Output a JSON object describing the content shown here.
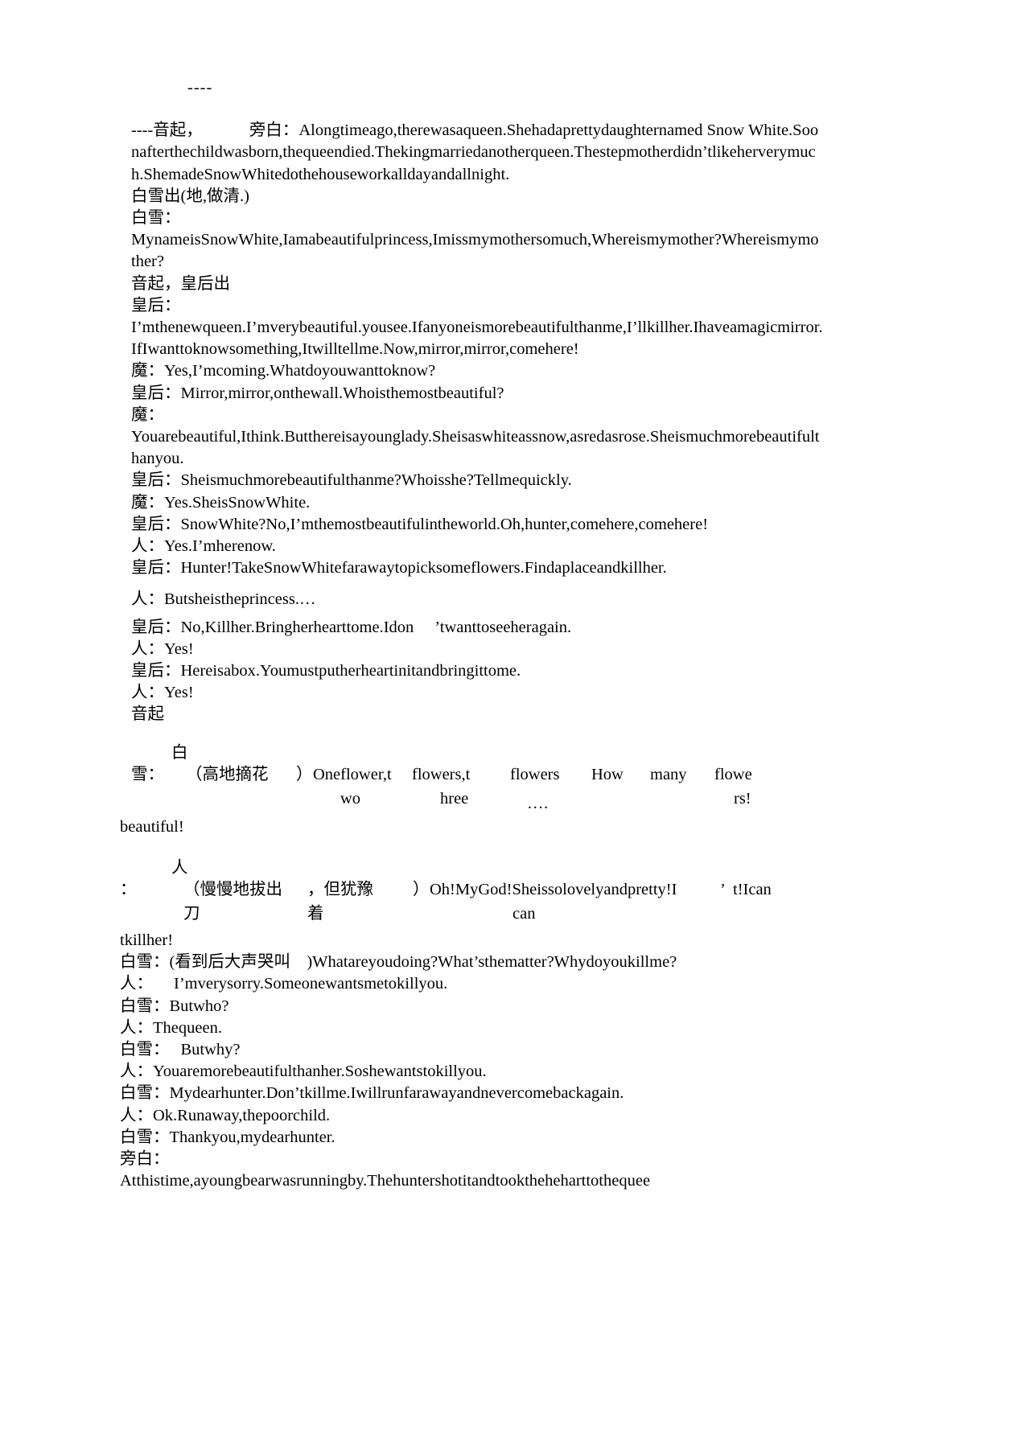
{
  "document": {
    "type": "play-script",
    "title_marker": "----",
    "language_mix": "chinese-english"
  },
  "lines": {
    "top_dashes": "----",
    "narration_opening_prefix": "----音起，",
    "narration_opening_speaker": "旁白：",
    "narration_opening_text": "Alongtimeago,therewasaqueen.Shehadaprettydaughternamed Snow White.Soonafterthechildwasborn,thequeendied.Thekingmarriedanotherqueen.Thestepmotherdidn’tlikeherverymuch.ShemadeSnowWhitedothehouseworkalldayandallnight.",
    "stage_snow_enter": "白雪出(地,做清.)",
    "snow_label_1": "白雪：",
    "snow_speech_1": "MynameisSnowWhite,Iamabeautifulprincess,Imissmymothersomuch,Whereismymother?Whereismymother?",
    "stage_queen_enter": "音起，皇后出",
    "queen_label_1": "皇后：",
    "queen_speech_1": "I’mthenewqueen.I’mverybeautiful.yousee.Ifanyoneismorebeautifulthanme,I’llkillher.Ihaveamagicmirror.IfIwanttoknowsomething,Itwilltellme.Now,mirror,mirror,comehere!",
    "mirror_line_1": "魔：Yes,I’mcoming.Whatdoyouwanttoknow?",
    "queen_line_2": "皇后：Mirror,mirror,onthewall.Whoisthemostbeautiful?",
    "mirror_label_2": "魔：",
    "mirror_speech_2": "Youarebeautiful,Ithink.Butthereisayounglady.Sheisaswhiteassnow,asredasrose.Sheismuchmorebeautifulthanyou.",
    "queen_line_3": "皇后：Sheismuchmorebeautifulthanme?Whoisshe?Tellmequickly.",
    "mirror_line_3": "魔：Yes.SheisSnowWhite.",
    "queen_line_4": "皇后：SnowWhite?No,I’mthemostbeautifulintheworld.Oh,hunter,comehere,comehere!",
    "hunter_line_1": "人：Yes.I’mherenow.",
    "queen_line_5": "皇后：Hunter!TakeSnowWhitefarawaytopicksomeflowers.Findaplaceandkillher.",
    "hunter_line_2": "人：Butsheistheprincess.…",
    "queen_line_6_a": "皇后：No,Killher.Bringherhearttome.Idon",
    "queen_line_6_apos": "’",
    "queen_line_6_b": "twanttoseeheragain.",
    "hunter_line_3": "人：Yes!",
    "queen_line_7": "皇后：Hereisabox.Youmustputherheartinitandbringittome.",
    "hunter_line_4": "人：Yes!",
    "stage_music": "音起",
    "snow_flower_cn_1": "白",
    "snow_flower_cn_2": "雪：",
    "snow_flower_stage": "（高地摘花",
    "snow_flower_paren": "）",
    "frag_one_flower": "Oneflower,t",
    "frag_wo": "wo",
    "frag_flowers_t": "flowers,t",
    "frag_hree": "hree",
    "frag_flowers": "flowers",
    "frag_dots": "….",
    "frag_how": "How",
    "frag_many": "many",
    "frag_flowe": "flowe",
    "frag_rs": "rs!",
    "frag_beautiful": "beautiful!",
    "hunter_knife_cn": "人",
    "hunter_knife_colon": "：",
    "hunter_knife_stage_a": "（慢慢地拔出",
    "hunter_knife_stage_b": "刀",
    "hunter_knife_stage_c": "，但犹豫",
    "hunter_knife_stage_d": "着",
    "hunter_knife_paren": "）",
    "hunter_knife_en_a": "Oh!MyGod!Sheissolovelyandpretty!I",
    "hunter_knife_can": "can",
    "hunter_knife_apos": "’",
    "hunter_knife_t": "t!Ican",
    "hunter_knife_tail": "tkillher!",
    "snow_line_cry": "白雪：(看到后大声哭叫　)Whatareyoudoing?What’sthematter?Whydoyoukillme?",
    "hunter_sorry_label": "人：",
    "hunter_sorry_text": "I’mverysorry.Someonewantsmetokillyou.",
    "snow_butwho": "白雪：Butwho?",
    "hunter_thequeen": "人：Thequeen.",
    "snow_butwhy_label": "白雪：",
    "snow_butwhy_text": "Butwhy?",
    "hunter_morebeautiful": "人：Youaremorebeautifulthanher.Soshewantstokillyou.",
    "snow_dearhunter": "白雪：Mydearhunter.Don’tkillme.Iwillrunfarawayandnevercomebackagain.",
    "hunter_runaway": "人：Ok.Runaway,thepoorchild.",
    "snow_thankyou": "白雪：Thankyou,mydearhunter.",
    "narration_label_2": "旁白：",
    "narration_text_2": "Atthistime,ayoungbearwasrunningby.Thehuntershotitandtooktheheharttothequee"
  }
}
